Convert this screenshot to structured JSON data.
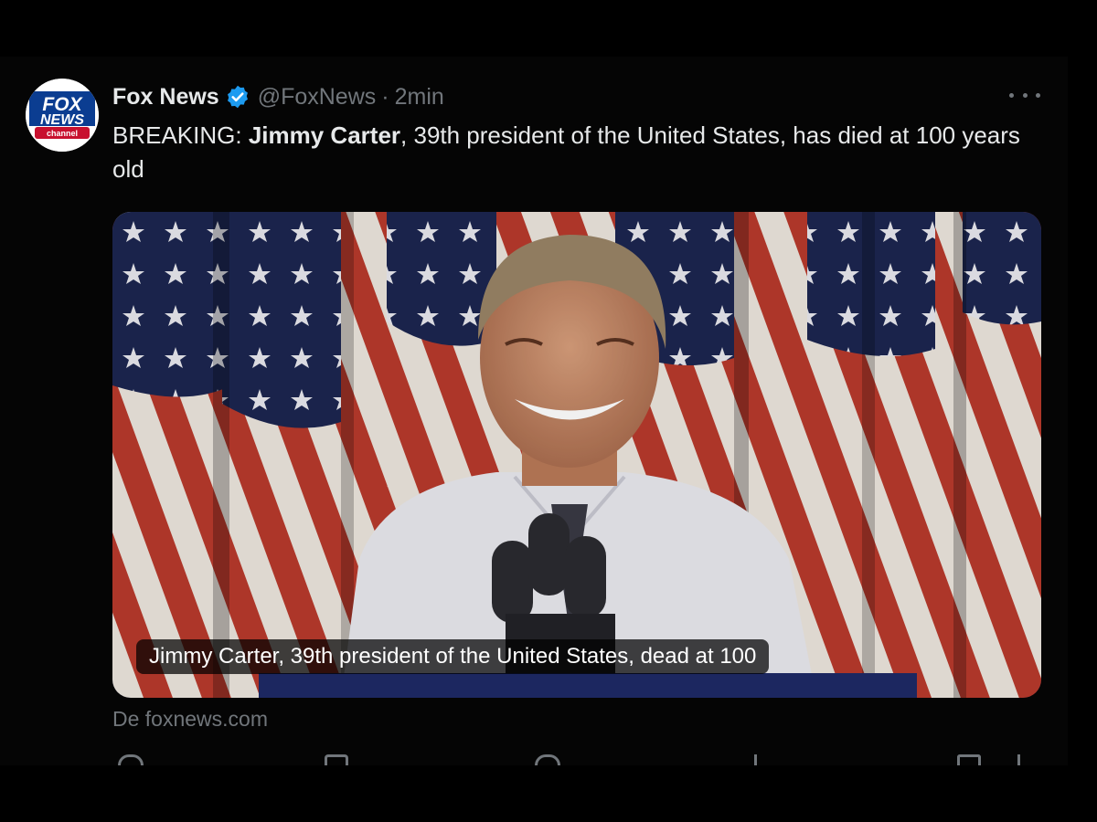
{
  "tweet": {
    "author": {
      "name": "Fox News",
      "handle": "@FoxNews",
      "separator": "·",
      "time": "2min",
      "avatar_icon": "fox-news-logo"
    },
    "logo": {
      "line1": "FOX",
      "line2": "NEWS",
      "line3": "channel"
    },
    "text": {
      "prefix": "BREAKING: ",
      "bold": "Jimmy Carter",
      "rest": ", 39th president of the United States, has died at 100 years old"
    },
    "media": {
      "caption": "Jimmy Carter, 39th president of the United States, dead at 100",
      "description_icon": "photo"
    },
    "source": "De foxnews.com",
    "more_icon": "more-horizontal-icon",
    "action_icons": [
      "reply-icon",
      "retweet-icon",
      "like-icon",
      "views-icon",
      "bookmark-icon",
      "share-icon"
    ]
  },
  "colors": {
    "background": "#000000",
    "text": "#e7e9ea",
    "muted": "#71767b",
    "verified": "#1d9bf0",
    "fox_red": "#c8102e",
    "fox_blue": "#003366"
  }
}
